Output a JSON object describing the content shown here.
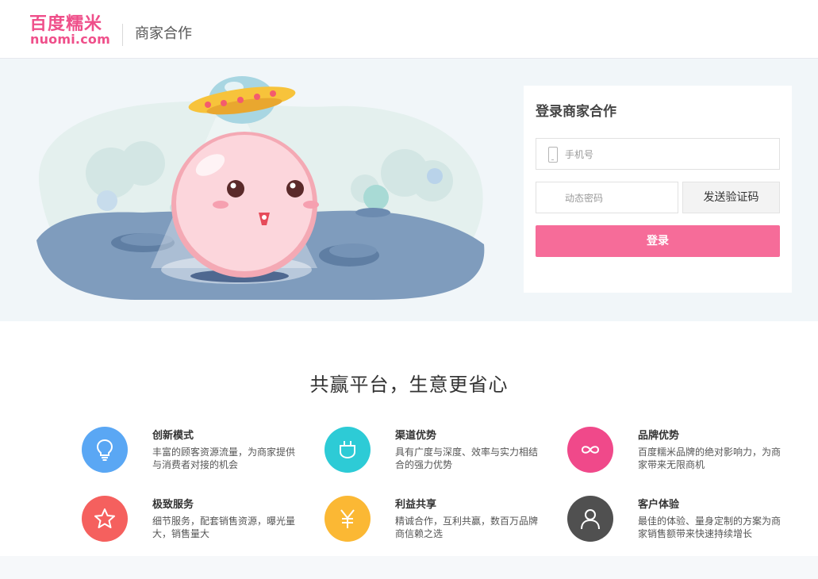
{
  "header": {
    "logo_cn": "百度糯米",
    "logo_en": "nuomi.com",
    "subtitle": "商家合作"
  },
  "login": {
    "title": "登录商家合作",
    "phone_placeholder": "手机号",
    "code_placeholder": "动态密码",
    "send_code_label": "发送验证码",
    "submit_label": "登录"
  },
  "features": {
    "title": "共赢平台，生意更省心",
    "items": [
      {
        "name": "创新模式",
        "desc": "丰富的顾客资源流量，为商家提供与消费者对接的机会",
        "icon": "lightbulb-icon",
        "color": "#5aa7f4"
      },
      {
        "name": "渠道优势",
        "desc": "具有广度与深度、效率与实力相结合的强力优势",
        "icon": "plug-icon",
        "color": "#2dcbd6"
      },
      {
        "name": "品牌优势",
        "desc": "百度糯米品牌的绝对影响力，为商家带来无限商机",
        "icon": "infinity-icon",
        "color": "#f0498a"
      },
      {
        "name": "极致服务",
        "desc": "细节服务，配套销售资源，曝光量大，销售量大",
        "icon": "star-icon",
        "color": "#f5605e"
      },
      {
        "name": "利益共享",
        "desc": "精诚合作，互利共赢，数百万品牌商信赖之选",
        "icon": "yen-icon",
        "color": "#fbb834"
      },
      {
        "name": "客户体验",
        "desc": "最佳的体验、量身定制的方案为商家销售额带来快速持续增长",
        "icon": "user-icon",
        "color": "#505050"
      }
    ]
  }
}
